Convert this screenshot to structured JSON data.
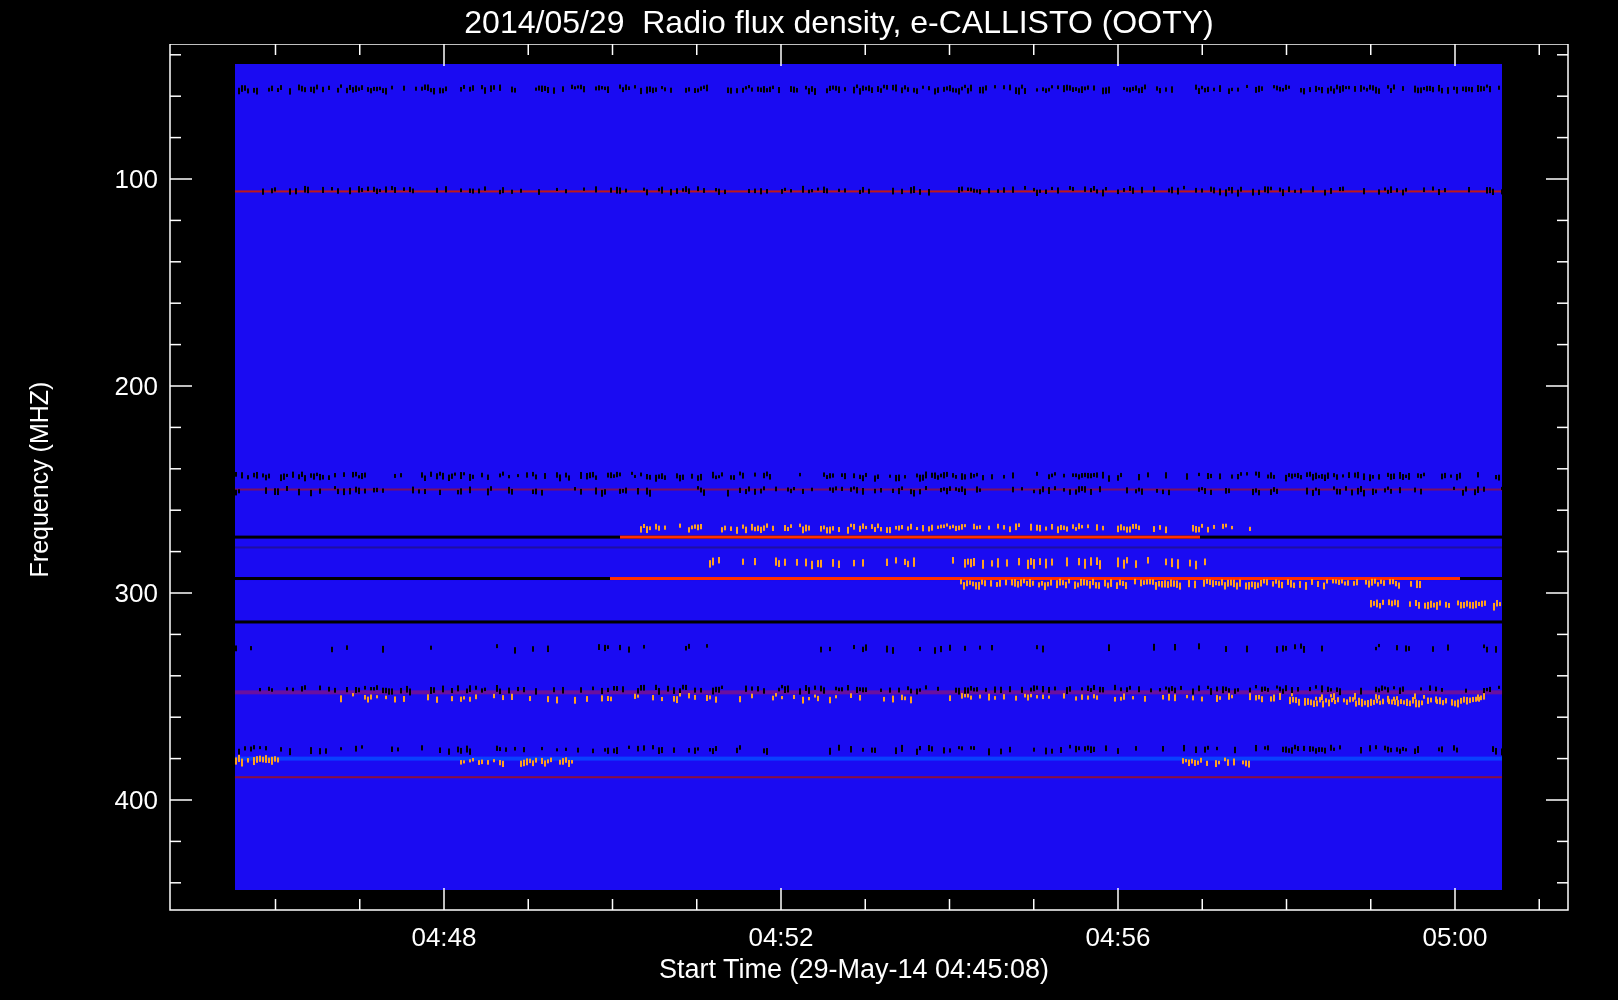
{
  "title": "2014/05/29  Radio flux density, e-CALLISTO (OOTY)",
  "y_axis": {
    "label": "Frequency (MHZ)",
    "ticks": [
      "100",
      "200",
      "300",
      "400"
    ]
  },
  "x_axis": {
    "label": "Start Time (29-May-14 04:45:08)",
    "ticks": [
      "04:48",
      "04:52",
      "04:56",
      "05:00"
    ]
  }
}
